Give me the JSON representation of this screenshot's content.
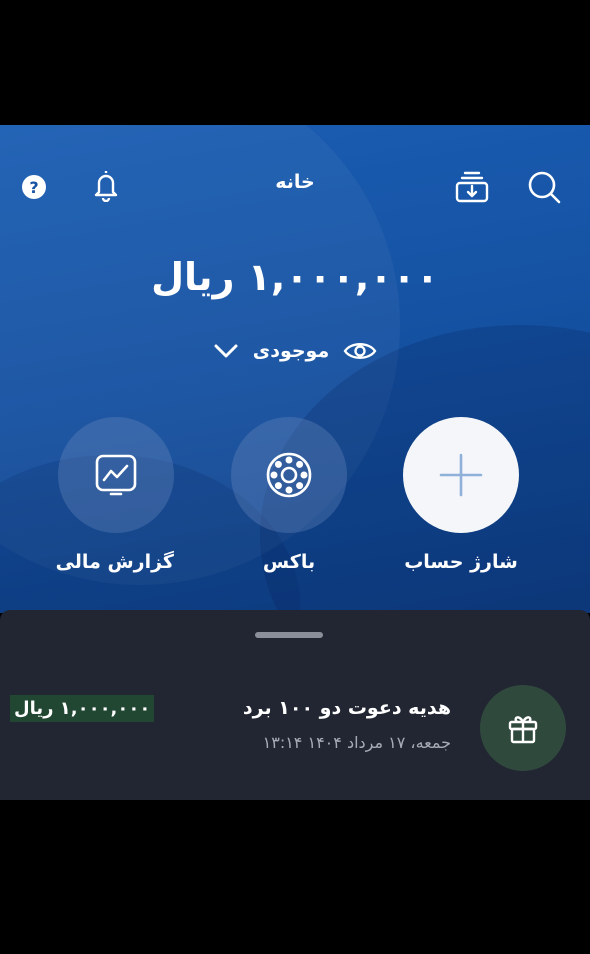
{
  "header": {
    "title": "خانه",
    "icons": [
      "help-icon",
      "bell-icon",
      "download-icon",
      "search-icon"
    ]
  },
  "balance": {
    "amount": "۱,۰۰۰,۰۰۰ ریال",
    "label": "موجودی",
    "icons": [
      "eye-icon",
      "chevron-down-icon"
    ]
  },
  "actions": [
    {
      "label": "شارژ حساب",
      "icon": "plus-icon"
    },
    {
      "label": "باکس",
      "icon": "box-icon"
    },
    {
      "label": "گزارش مالی",
      "icon": "chart-icon"
    }
  ],
  "transaction": {
    "title": "هدیه دعوت دو ۱۰۰ برد",
    "date": "جمعه، ۱۷ مرداد ۱۴۰۴ ۱۳:۱۴",
    "amount": "۱,۰۰۰,۰۰۰ ریال",
    "icon": "gift-icon"
  },
  "colors": {
    "hero_blue": "#1552a3",
    "sheet_bg": "#222632",
    "amount_highlight": "#214733",
    "gift_circle": "#2f4a3c"
  }
}
